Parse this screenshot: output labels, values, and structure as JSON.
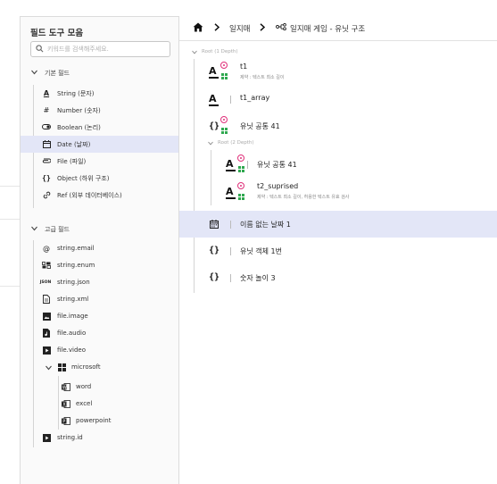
{
  "panel": {
    "title": "필드 도구 모음",
    "search_placeholder": "키워드를 검색해주세요.",
    "basic_group": "기본 필드",
    "advanced_group": "고급 필드",
    "basic_items": [
      {
        "label": "String (문자)",
        "icon": "text-icon"
      },
      {
        "label": "Number (숫자)",
        "icon": "hash-icon"
      },
      {
        "label": "Boolean (논리)",
        "icon": "toggle-icon"
      },
      {
        "label": "Date (날짜)",
        "icon": "calendar-icon"
      },
      {
        "label": "File (파일)",
        "icon": "paperclip-icon"
      },
      {
        "label": "Object (하위 구조)",
        "icon": "braces-icon"
      },
      {
        "label": "Ref (외부 데이터베이스)",
        "icon": "link-icon"
      }
    ],
    "advanced_items": [
      {
        "label": "string.email",
        "icon": "at-icon"
      },
      {
        "label": "string.enum",
        "icon": "enum-icon"
      },
      {
        "label": "string.json",
        "icon": "json-icon"
      },
      {
        "label": "string.xml",
        "icon": "xml-icon"
      },
      {
        "label": "file.image",
        "icon": "image-icon"
      },
      {
        "label": "file.audio",
        "icon": "audio-icon"
      },
      {
        "label": "file.video",
        "icon": "video-icon"
      },
      {
        "label": "microsoft",
        "icon": "windows-icon"
      },
      {
        "label": "word",
        "icon": "word-icon"
      },
      {
        "label": "excel",
        "icon": "excel-icon"
      },
      {
        "label": "powerpoint",
        "icon": "powerpoint-icon"
      },
      {
        "label": "string.id",
        "icon": "id-icon"
      }
    ]
  },
  "breadcrumb": {
    "home_icon": "home-icon",
    "level1": "일지매",
    "level2": "일지매 게임 - 유닛 구조"
  },
  "structure": {
    "root1_label": "Root (1 Depth)",
    "root2_label": "Root (2 Depth)",
    "rows": [
      {
        "label": "t1",
        "sub": "제약 : 텍스트 최소 길이"
      },
      {
        "label": "t1_array",
        "sub": ""
      },
      {
        "label": "유닛 공통 41",
        "sub": ""
      },
      {
        "label": "유닛 공통 41",
        "sub": ""
      },
      {
        "label": "t2_suprised",
        "sub": "제약 : 텍스트 최소 길이, 허용한 텍스트 유효 검사"
      },
      {
        "label": "이름 없는 날짜 1",
        "sub": ""
      },
      {
        "label": "유닛 객체 1번",
        "sub": ""
      },
      {
        "label": "숫자 놀이 3",
        "sub": ""
      }
    ]
  },
  "colors": {
    "accent_bg": "#e3e6f7",
    "pink": "#e0307a",
    "green": "#2fa84f"
  }
}
